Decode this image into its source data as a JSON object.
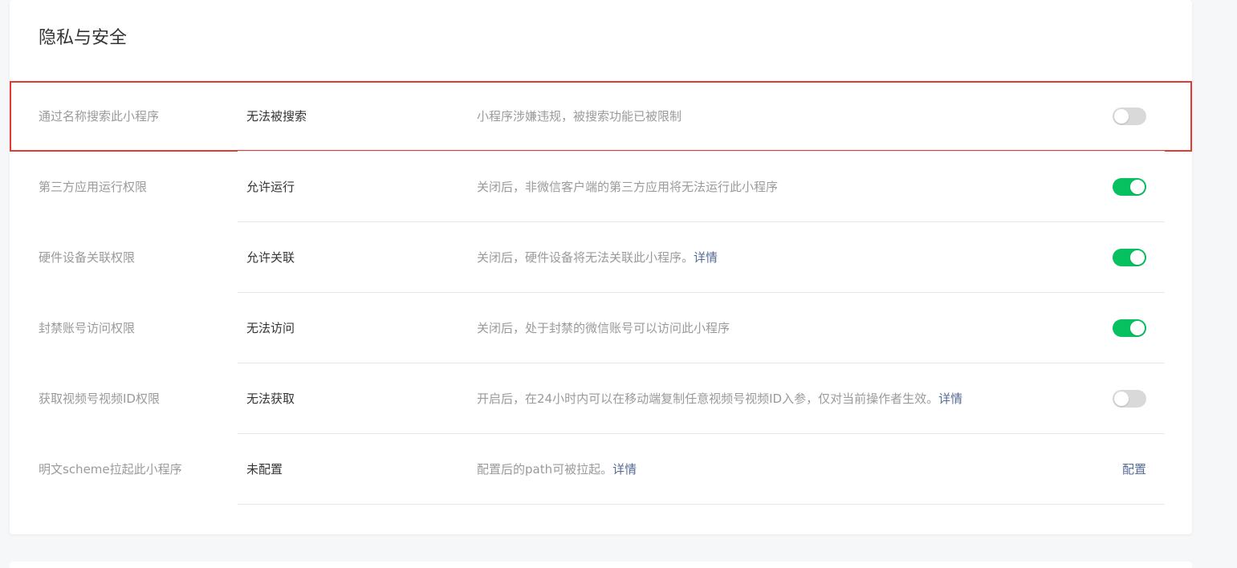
{
  "section": {
    "title": "隐私与安全"
  },
  "rows": [
    {
      "label": "通过名称搜索此小程序",
      "value": "无法被搜索",
      "desc": "小程序涉嫌违规，被搜索功能已被限制",
      "link": "",
      "toggle": "off"
    },
    {
      "label": "第三方应用运行权限",
      "value": "允许运行",
      "desc": "关闭后，非微信客户端的第三方应用将无法运行此小程序",
      "link": "",
      "toggle": "on"
    },
    {
      "label": "硬件设备关联权限",
      "value": "允许关联",
      "desc": "关闭后，硬件设备将无法关联此小程序。",
      "link": "详情",
      "toggle": "on"
    },
    {
      "label": "封禁账号访问权限",
      "value": "无法访问",
      "desc": "关闭后，处于封禁的微信账号可以访问此小程序",
      "link": "",
      "toggle": "on"
    },
    {
      "label": "获取视频号视频ID权限",
      "value": "无法获取",
      "desc": "开启后，在24小时内可以在移动端复制任意视频号视频ID入参，仅对当前操作者生效。",
      "link": "详情",
      "toggle": "off"
    },
    {
      "label": "明文scheme拉起此小程序",
      "value": "未配置",
      "desc": "配置后的path可被拉起。",
      "link": "详情",
      "action": "配置"
    }
  ],
  "colors": {
    "accent": "#07c160",
    "link": "#576b95",
    "highlight": "#e33b33"
  }
}
